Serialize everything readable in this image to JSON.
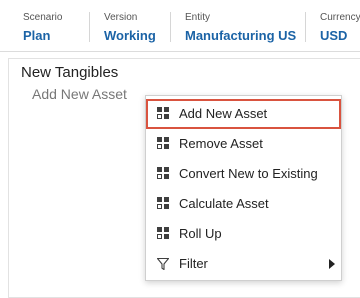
{
  "pov": [
    {
      "label": "Scenario",
      "value": "Plan"
    },
    {
      "label": "Version",
      "value": "Working"
    },
    {
      "label": "Entity",
      "value": "Manufacturing US"
    },
    {
      "label": "Currency",
      "value": "USD"
    }
  ],
  "panel": {
    "title": "New Tangibles",
    "add_row_text": "Add New Asset"
  },
  "context_menu": {
    "items": [
      {
        "label": "Add New Asset",
        "icon": "grid-icon",
        "focused": true
      },
      {
        "label": "Remove Asset",
        "icon": "grid-icon"
      },
      {
        "label": "Convert New to Existing",
        "icon": "grid-icon"
      },
      {
        "label": "Calculate Asset",
        "icon": "grid-icon"
      },
      {
        "label": "Roll Up",
        "icon": "grid-icon"
      },
      {
        "label": "Filter",
        "icon": "filter-icon",
        "has_submenu": true
      }
    ]
  },
  "colors": {
    "pov_value": "#1b63a6",
    "focus_outline": "#d9533f"
  }
}
